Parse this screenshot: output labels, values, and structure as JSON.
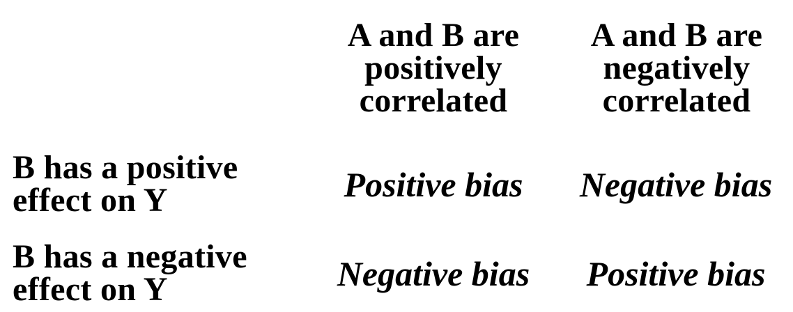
{
  "columns": [
    {
      "header": [
        "A and B are",
        "positively",
        "correlated"
      ]
    },
    {
      "header": [
        "A and B are",
        "negatively",
        "correlated"
      ]
    }
  ],
  "rows": [
    {
      "header": [
        "B has a positive",
        "effect on Y"
      ],
      "cells": [
        "Positive bias",
        "Negative bias"
      ]
    },
    {
      "header": [
        "B has a negative",
        "effect on Y"
      ],
      "cells": [
        "Negative bias",
        "Positive bias"
      ]
    }
  ]
}
